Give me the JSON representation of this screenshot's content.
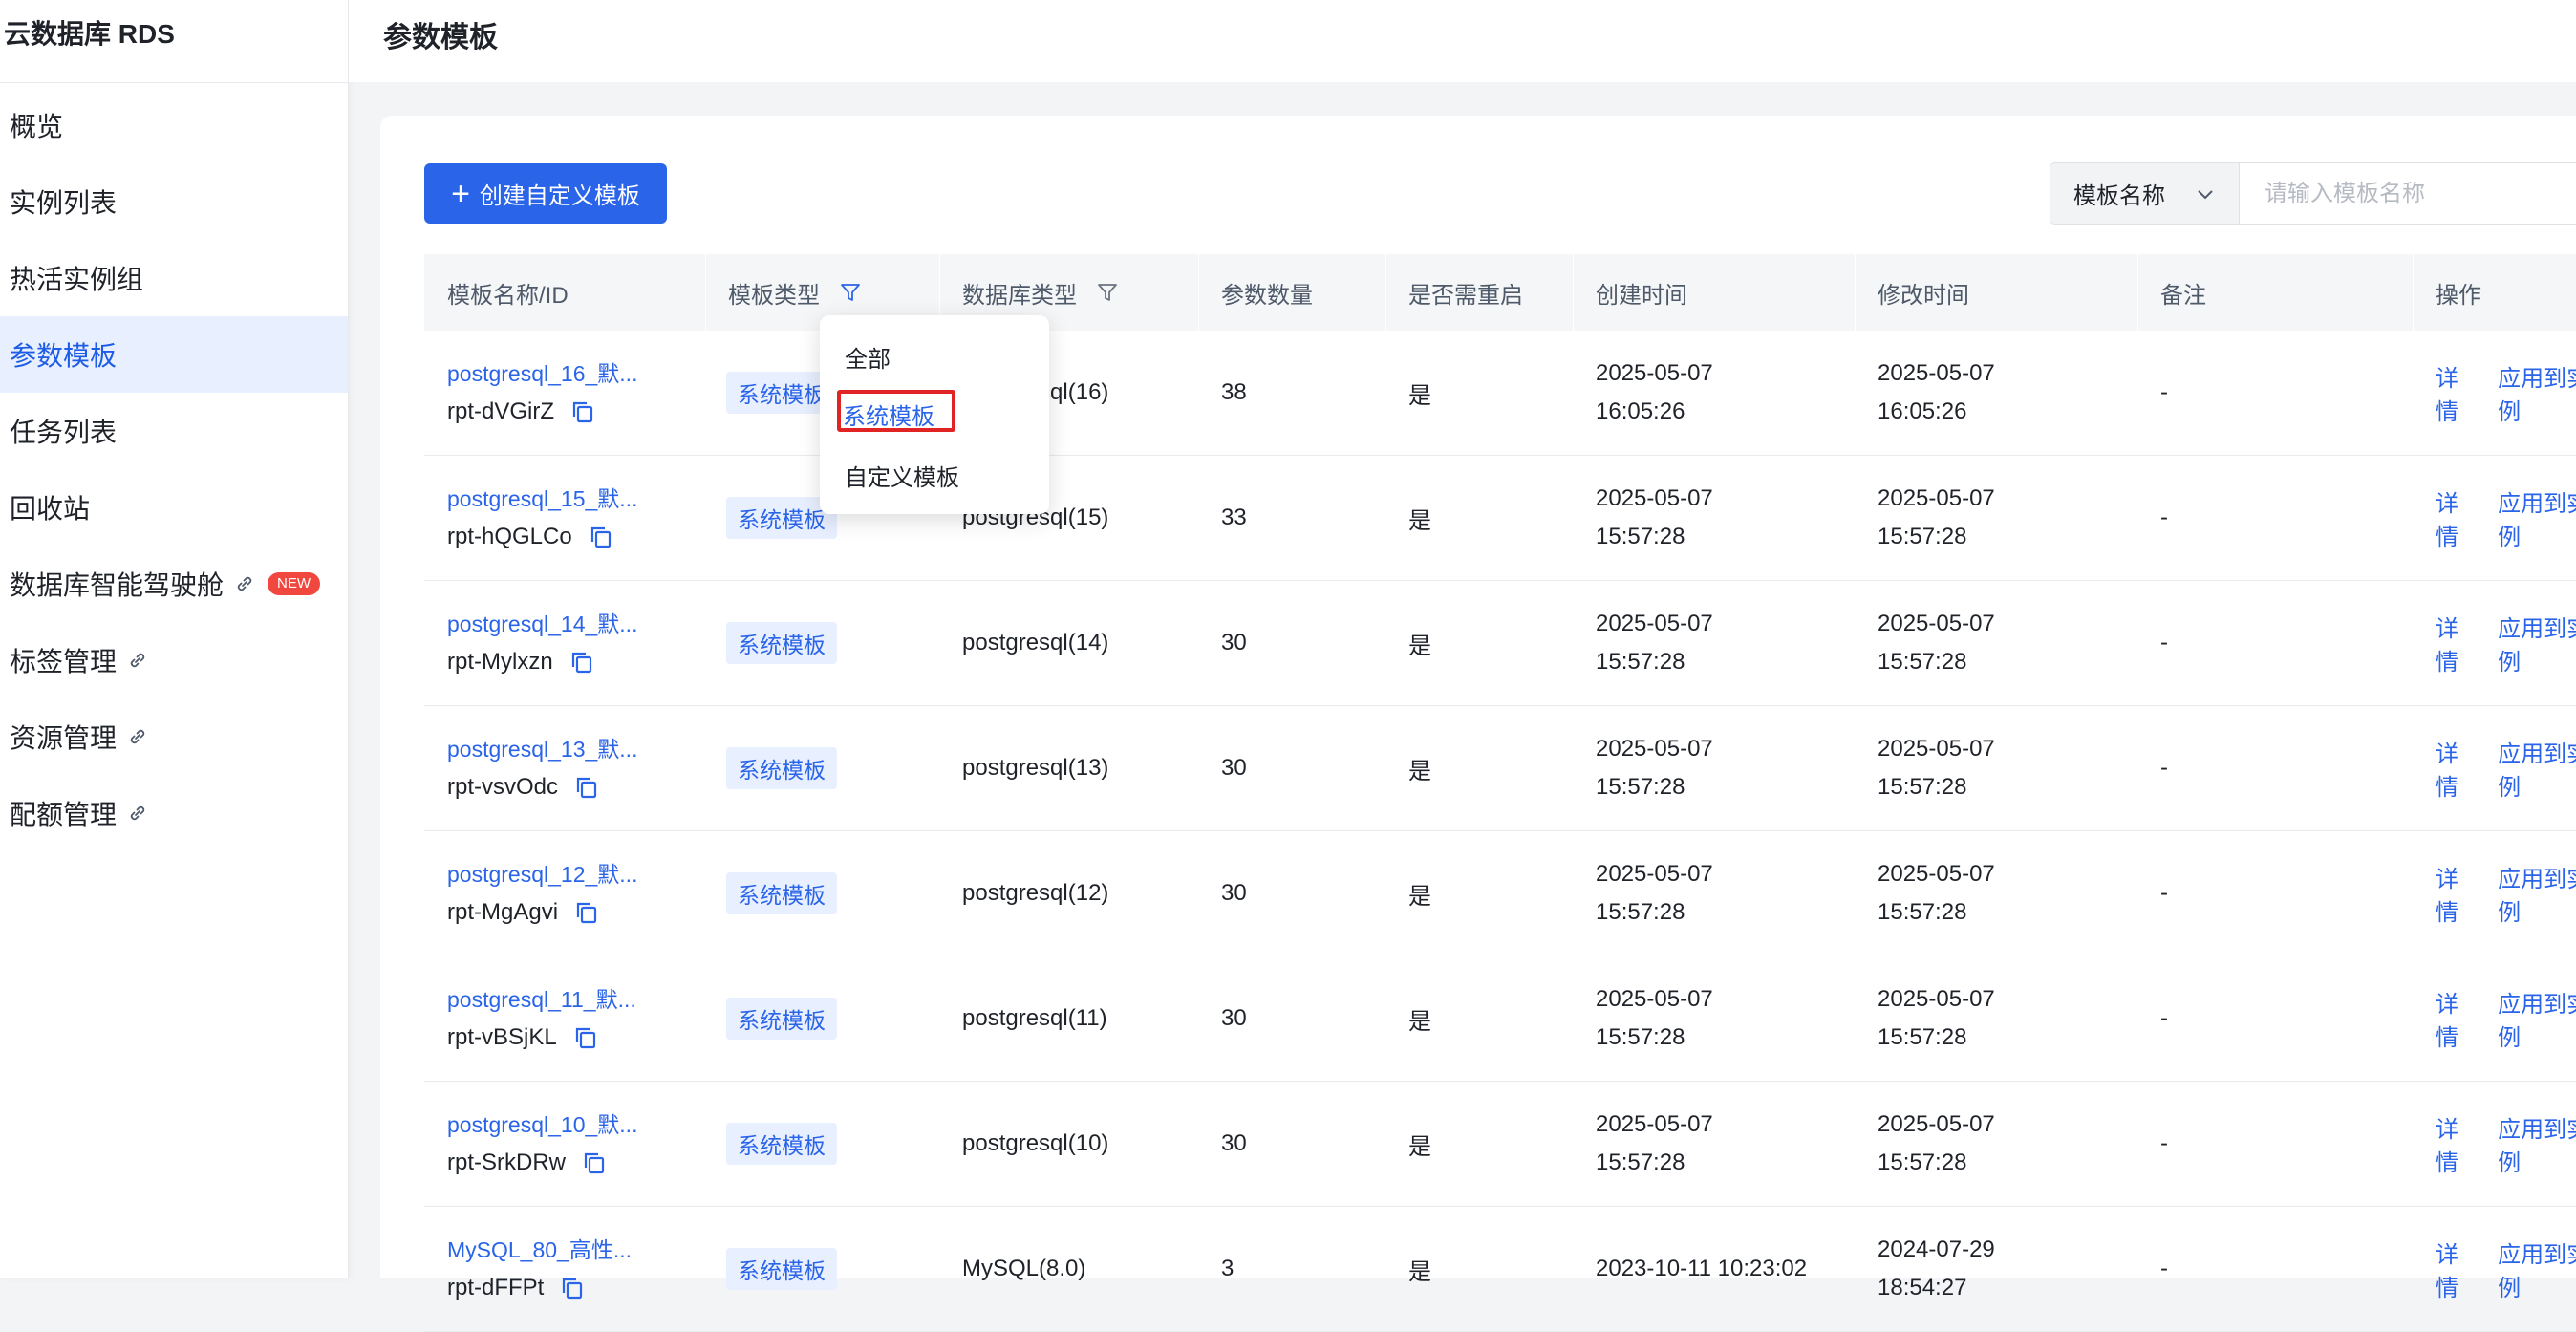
{
  "sidebar": {
    "title": "云数据库 RDS",
    "items": [
      {
        "label": "概览",
        "active": false,
        "external": false
      },
      {
        "label": "实例列表",
        "active": false,
        "external": false
      },
      {
        "label": "热活实例组",
        "active": false,
        "external": false
      },
      {
        "label": "参数模板",
        "active": true,
        "external": false
      },
      {
        "label": "任务列表",
        "active": false,
        "external": false
      },
      {
        "label": "回收站",
        "active": false,
        "external": false
      },
      {
        "label": "数据库智能驾驶舱",
        "active": false,
        "external": true,
        "badge": "NEW"
      },
      {
        "label": "标签管理",
        "active": false,
        "external": true
      },
      {
        "label": "资源管理",
        "active": false,
        "external": true
      },
      {
        "label": "配额管理",
        "active": false,
        "external": true
      }
    ]
  },
  "header": {
    "title": "参数模板"
  },
  "toolbar": {
    "create_label": "创建自定义模板",
    "search_field": "模板名称",
    "search_placeholder": "请输入模板名称"
  },
  "table": {
    "columns": [
      "模板名称/ID",
      "模板类型",
      "数据库类型",
      "参数数量",
      "是否需重启",
      "创建时间",
      "修改时间",
      "备注",
      "操作"
    ],
    "rows": [
      {
        "name": "postgresql_16_默...",
        "id": "rpt-dVGirZ",
        "type": "系统模板",
        "db": "postgresql(16)",
        "count": "38",
        "restart": "是",
        "created_date": "2025-05-07",
        "created_time": "16:05:26",
        "modified_date": "2025-05-07",
        "modified_time": "16:05:26",
        "note": "-",
        "op1": "详情",
        "op2": "应用到实例"
      },
      {
        "name": "postgresql_15_默...",
        "id": "rpt-hQGLCo",
        "type": "系统模板",
        "db": "postgresql(15)",
        "count": "33",
        "restart": "是",
        "created_date": "2025-05-07",
        "created_time": "15:57:28",
        "modified_date": "2025-05-07",
        "modified_time": "15:57:28",
        "note": "-",
        "op1": "详情",
        "op2": "应用到实例"
      },
      {
        "name": "postgresql_14_默...",
        "id": "rpt-Mylxzn",
        "type": "系统模板",
        "db": "postgresql(14)",
        "count": "30",
        "restart": "是",
        "created_date": "2025-05-07",
        "created_time": "15:57:28",
        "modified_date": "2025-05-07",
        "modified_time": "15:57:28",
        "note": "-",
        "op1": "详情",
        "op2": "应用到实例"
      },
      {
        "name": "postgresql_13_默...",
        "id": "rpt-vsvOdc",
        "type": "系统模板",
        "db": "postgresql(13)",
        "count": "30",
        "restart": "是",
        "created_date": "2025-05-07",
        "created_time": "15:57:28",
        "modified_date": "2025-05-07",
        "modified_time": "15:57:28",
        "note": "-",
        "op1": "详情",
        "op2": "应用到实例"
      },
      {
        "name": "postgresql_12_默...",
        "id": "rpt-MgAgvi",
        "type": "系统模板",
        "db": "postgresql(12)",
        "count": "30",
        "restart": "是",
        "created_date": "2025-05-07",
        "created_time": "15:57:28",
        "modified_date": "2025-05-07",
        "modified_time": "15:57:28",
        "note": "-",
        "op1": "详情",
        "op2": "应用到实例"
      },
      {
        "name": "postgresql_11_默...",
        "id": "rpt-vBSjKL",
        "type": "系统模板",
        "db": "postgresql(11)",
        "count": "30",
        "restart": "是",
        "created_date": "2025-05-07",
        "created_time": "15:57:28",
        "modified_date": "2025-05-07",
        "modified_time": "15:57:28",
        "note": "-",
        "op1": "详情",
        "op2": "应用到实例"
      },
      {
        "name": "postgresql_10_默...",
        "id": "rpt-SrkDRw",
        "type": "系统模板",
        "db": "postgresql(10)",
        "count": "30",
        "restart": "是",
        "created_date": "2025-05-07",
        "created_time": "15:57:28",
        "modified_date": "2025-05-07",
        "modified_time": "15:57:28",
        "note": "-",
        "op1": "详情",
        "op2": "应用到实例"
      },
      {
        "name": "MySQL_80_高性...",
        "id": "rpt-dFFPt",
        "type": "系统模板",
        "db": "MySQL(8.0)",
        "count": "3",
        "restart": "是",
        "created_date": "2023-10-11 10:23:02",
        "created_time": "",
        "modified_date": "2024-07-29",
        "modified_time": "18:54:27",
        "note": "-",
        "op1": "详情",
        "op2": "应用到实例"
      }
    ]
  },
  "filter_dropdown": {
    "options": [
      "全部",
      "系统模板",
      "自定义模板"
    ],
    "selected": "系统模板"
  },
  "colors": {
    "primary": "#2a64e8",
    "highlight_border": "#e02424",
    "badge": "#f0483e"
  }
}
